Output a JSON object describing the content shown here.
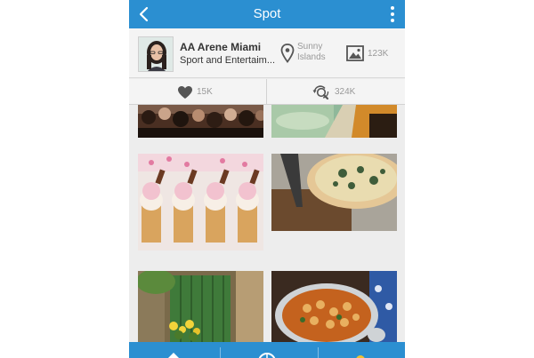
{
  "header": {
    "title": "Spot",
    "back_icon": "chevron-left-icon",
    "menu_icon": "more-vertical-icon",
    "color": "#2b8fd1"
  },
  "spot": {
    "name": "AA Arene Miami",
    "category": "Sport and Entertaim...",
    "location_line1": "Sunny",
    "location_line2": "Islands",
    "photos_count": "123K",
    "location_icon": "map-pin-icon",
    "photos_icon": "image-icon"
  },
  "stats": {
    "likes": "15K",
    "views": "324K",
    "likes_icon": "heart-icon",
    "views_icon": "search-refresh-icon"
  },
  "photos": [
    {
      "subject": "crowd"
    },
    {
      "subject": "poolside-drink"
    },
    {
      "subject": "ice-cream-cones"
    },
    {
      "subject": "quiche-pie"
    },
    {
      "subject": "green-door-flowers"
    },
    {
      "subject": "chickpea-stew"
    }
  ],
  "bottom_nav": {
    "items": [
      {
        "icon": "home-icon"
      },
      {
        "icon": "globe-icon"
      },
      {
        "icon": "user-icon"
      }
    ]
  }
}
